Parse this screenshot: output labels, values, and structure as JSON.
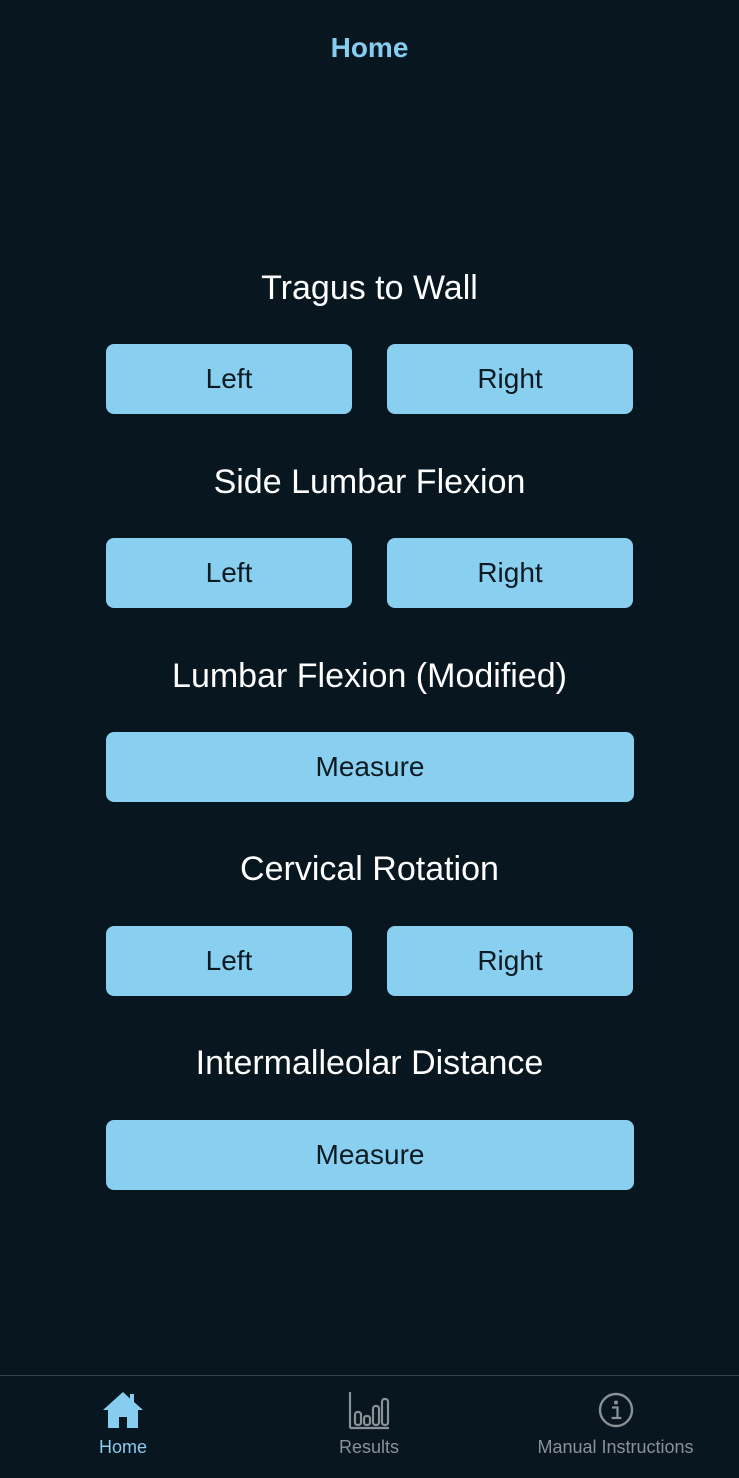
{
  "header": {
    "title": "Home"
  },
  "sections": [
    {
      "title": "Tragus to Wall",
      "buttons": [
        "Left",
        "Right"
      ]
    },
    {
      "title": "Side Lumbar Flexion",
      "buttons": [
        "Left",
        "Right"
      ]
    },
    {
      "title": "Lumbar Flexion (Modified)",
      "buttons": [
        "Measure"
      ]
    },
    {
      "title": "Cervical Rotation",
      "buttons": [
        "Left",
        "Right"
      ]
    },
    {
      "title": "Intermalleolar Distance",
      "buttons": [
        "Measure"
      ]
    }
  ],
  "tabbar": {
    "tabs": [
      {
        "label": "Home",
        "icon": "house-icon",
        "active": true
      },
      {
        "label": "Results",
        "icon": "bar-chart-icon",
        "active": false
      },
      {
        "label": "Manual Instructions",
        "icon": "info-circle-icon",
        "active": false
      }
    ]
  },
  "colors": {
    "background": "#07161f",
    "accent": "#87cdf0",
    "button": "#89cff0",
    "button_text": "#0c1a22",
    "inactive_tab": "#8a9197"
  }
}
